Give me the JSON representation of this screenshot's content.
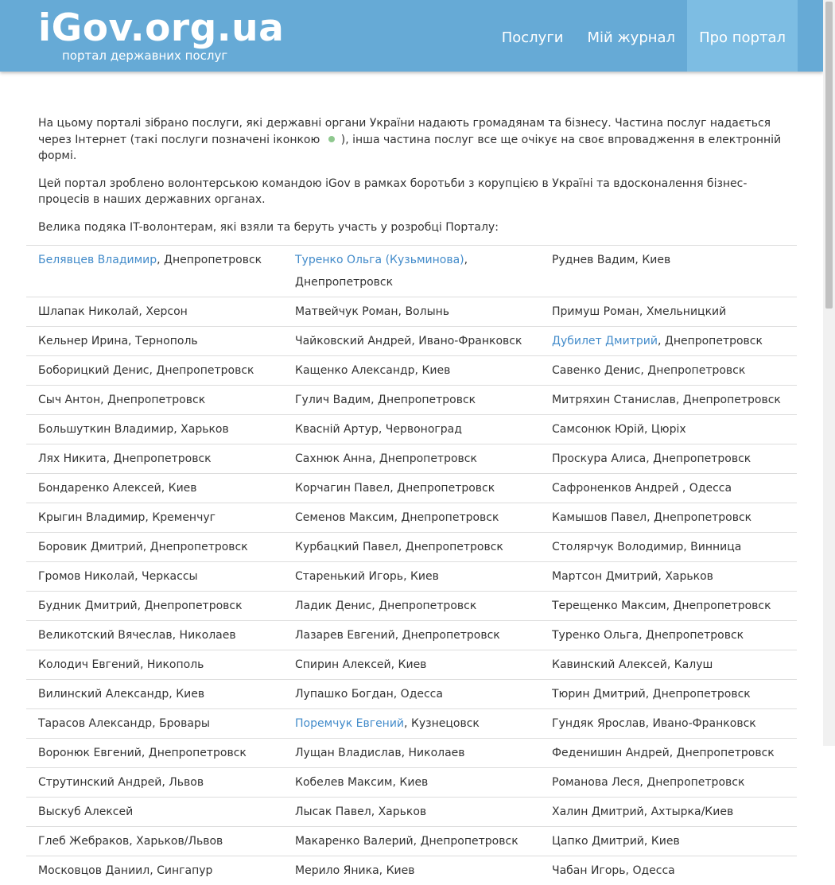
{
  "header": {
    "logo": "iGov.org.ua",
    "tagline": "портал державних послуг",
    "nav": [
      {
        "label": "Послуги"
      },
      {
        "label": "Мій журнал"
      },
      {
        "label": "Про портал"
      }
    ]
  },
  "intro": {
    "p1_before": "На цьому порталі зібрано послуги, які державні органи України надають громадянам та бізнесу. Частина послуг надається через Інтернет (такі послуги позначені іконкою",
    "p1_after": "), інша частина послуг все ще очікує на своє впровадження в електронній формі.",
    "p2": "Цей портал зроблено волонтерською командою iGov в рамках боротьби з корупцією в Україні та вдосконалення бізнес-процесів в наших державних органах.",
    "p3": "Велика подяка IT-волонтерам, які взяли та беруть участь у розробці Порталу:"
  },
  "colors": {
    "header": "#66aad6",
    "active_tab": "#7dbde3",
    "link": "#428bca",
    "online_dot": "#8ec88e"
  },
  "volunteers": [
    [
      {
        "name": "Белявцев Владимир",
        "link": true,
        "city": "Днепропетровск"
      },
      {
        "name": "Туренко Ольга (Кузьминова)",
        "link": true,
        "city": "Днепропетровск"
      },
      {
        "name": "Руднев Вадим",
        "link": false,
        "city": "Киев"
      }
    ],
    [
      {
        "name": "Шлапак Николай",
        "link": false,
        "city": "Херсон"
      },
      {
        "name": "Матвейчук Роман",
        "link": false,
        "city": "Волынь"
      },
      {
        "name": "Примуш Роман",
        "link": false,
        "city": "Хмельницкий"
      }
    ],
    [
      {
        "name": "Кельнер Ирина",
        "link": false,
        "city": "Тернополь"
      },
      {
        "name": "Чайковский Андрей",
        "link": false,
        "city": "Ивано-Франковск"
      },
      {
        "name": "Дубилет Дмитрий",
        "link": true,
        "city": "Днепропетровск"
      }
    ],
    [
      {
        "name": "Боборицкий Денис",
        "link": false,
        "city": "Днепропетровск"
      },
      {
        "name": "Кащенко Александр",
        "link": false,
        "city": "Киев"
      },
      {
        "name": "Савенко Денис",
        "link": false,
        "city": "Днепропетровск"
      }
    ],
    [
      {
        "name": "Сыч Антон",
        "link": false,
        "city": "Днепропетровск"
      },
      {
        "name": "Гулич Вадим",
        "link": false,
        "city": "Днепропетровск"
      },
      {
        "name": "Митряхин Станислав",
        "link": false,
        "city": "Днепропетровск"
      }
    ],
    [
      {
        "name": "Большуткин Владимир",
        "link": false,
        "city": "Харьков"
      },
      {
        "name": "Квасній Артур",
        "link": false,
        "city": "Червоноград"
      },
      {
        "name": "Самсонюк Юрій",
        "link": false,
        "city": "Цюріх"
      }
    ],
    [
      {
        "name": "Лях Никита",
        "link": false,
        "city": "Днепропетровск"
      },
      {
        "name": "Сахнюк Анна",
        "link": false,
        "city": "Днепропетровск"
      },
      {
        "name": "Проскура Алиса",
        "link": false,
        "city": "Днепропетровск"
      }
    ],
    [
      {
        "name": "Бондаренко Алексей",
        "link": false,
        "city": "Киев"
      },
      {
        "name": "Корчагин Павел",
        "link": false,
        "city": "Днепропетровск"
      },
      {
        "name": "Сафроненков Андрей ",
        "link": false,
        "city": "Одесса"
      }
    ],
    [
      {
        "name": "Крыгин Владимир",
        "link": false,
        "city": "Кременчуг"
      },
      {
        "name": "Семенов Максим",
        "link": false,
        "city": "Днепропетровск"
      },
      {
        "name": "Камышов Павел",
        "link": false,
        "city": "Днепропетровск"
      }
    ],
    [
      {
        "name": "Боровик Дмитрий",
        "link": false,
        "city": "Днепропетровск"
      },
      {
        "name": "Курбацкий Павел",
        "link": false,
        "city": "Днепропетровск"
      },
      {
        "name": "Столярчук Володимир",
        "link": false,
        "city": "Винница"
      }
    ],
    [
      {
        "name": "Громов Николай",
        "link": false,
        "city": "Черкассы"
      },
      {
        "name": "Старенький Игорь",
        "link": false,
        "city": "Киев"
      },
      {
        "name": "Мартсон Дмитрий",
        "link": false,
        "city": "Харьков"
      }
    ],
    [
      {
        "name": "Будник Дмитрий",
        "link": false,
        "city": "Днепропетровск"
      },
      {
        "name": "Ладик Денис",
        "link": false,
        "city": "Днепропетровск"
      },
      {
        "name": "Терещенко Максим",
        "link": false,
        "city": "Днепропетровск"
      }
    ],
    [
      {
        "name": "Великотский Вячеслав",
        "link": false,
        "city": "Николаев"
      },
      {
        "name": "Лазарев Евгений",
        "link": false,
        "city": "Днепропетровск"
      },
      {
        "name": "Туренко Ольга",
        "link": false,
        "city": "Днепропетровск"
      }
    ],
    [
      {
        "name": "Колодич Евгений",
        "link": false,
        "city": "Никополь"
      },
      {
        "name": "Спирин Алексей",
        "link": false,
        "city": "Киев"
      },
      {
        "name": "Кавинский Алексей",
        "link": false,
        "city": "Калуш"
      }
    ],
    [
      {
        "name": "Вилинский Александр",
        "link": false,
        "city": "Киев"
      },
      {
        "name": "Лупашко Богдан",
        "link": false,
        "city": "Одесса"
      },
      {
        "name": "Тюрин Дмитрий",
        "link": false,
        "city": "Днепропетровск"
      }
    ],
    [
      {
        "name": "Тарасов Александр",
        "link": false,
        "city": "Бровары"
      },
      {
        "name": "Поремчук Евгений",
        "link": true,
        "city": "Кузнецовск"
      },
      {
        "name": "Гундяк Ярослав",
        "link": false,
        "city": "Ивано-Франковск"
      }
    ],
    [
      {
        "name": "Воронюк Евгений",
        "link": false,
        "city": "Днепропетровск"
      },
      {
        "name": "Лущан Владислав",
        "link": false,
        "city": "Николаев"
      },
      {
        "name": "Феденишин Андрей",
        "link": false,
        "city": "Днепропетровск"
      }
    ],
    [
      {
        "name": "Струтинский Андрей",
        "link": false,
        "city": "Львов"
      },
      {
        "name": "Кобелев Максим",
        "link": false,
        "city": "Киев"
      },
      {
        "name": "Романова Леся",
        "link": false,
        "city": "Днепропетровск"
      }
    ],
    [
      {
        "name": "Выскуб Алексей",
        "link": false,
        "city": ""
      },
      {
        "name": "Лысак Павел",
        "link": false,
        "city": "Харьков"
      },
      {
        "name": "Халин Дмитрий",
        "link": false,
        "city": "Ахтырка/Киев"
      }
    ],
    [
      {
        "name": "Глеб Жебраков",
        "link": false,
        "city": "Харьков/Львов"
      },
      {
        "name": "Макаренко Валерий",
        "link": false,
        "city": "Днепропетровск"
      },
      {
        "name": "Цапко Дмитрий",
        "link": false,
        "city": "Киев"
      }
    ],
    [
      {
        "name": "Московцов Даниил",
        "link": false,
        "city": "Сингапур"
      },
      {
        "name": "Мерило Яника",
        "link": false,
        "city": "Киев"
      },
      {
        "name": "Чабан Игорь",
        "link": false,
        "city": "Одесса"
      }
    ]
  ]
}
